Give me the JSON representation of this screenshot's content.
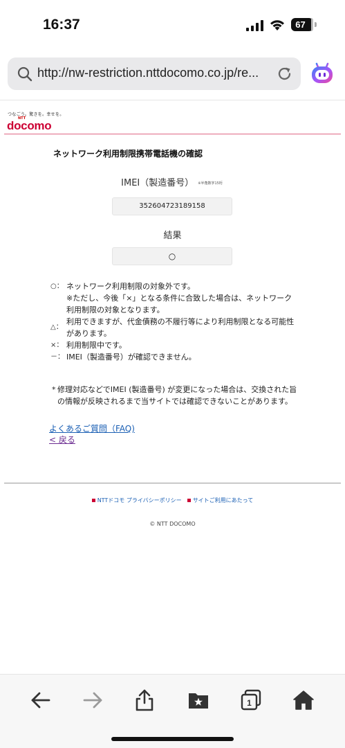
{
  "status": {
    "time": "16:37",
    "battery": "67"
  },
  "browser": {
    "url": "http://nw-restriction.nttdocomo.co.jp/re..."
  },
  "site": {
    "tagline": "つなごう。驚きを。幸せを。",
    "ntt_label": "NTT",
    "logo": "docomo",
    "page_title": "ネットワーク利用制限携帯電話機の確認",
    "imei_label": "IMEI（製造番号）",
    "imei_note": "※半角数字15桁",
    "imei_value": "352604723189158",
    "result_label": "結果",
    "result_value": "○"
  },
  "legend": [
    {
      "symbol": "○：",
      "text": "ネットワーク利用制限の対象外です。"
    },
    {
      "symbol": "",
      "text": "※ただし、今後「×」となる条件に合致した場合は、ネットワーク利用制限の対象となります。"
    },
    {
      "symbol": "△：",
      "text": "利用できますが、代金債務の不履行等により利用制限となる可能性があります。"
    },
    {
      "symbol": "×：",
      "text": "利用制限中です。"
    },
    {
      "symbol": "－：",
      "text": "IMEI（製造番号）が確認できません。"
    }
  ],
  "note": {
    "mark": "*",
    "text": "修理対応などでIMEI (製造番号) が変更になった場合は、交換された旨の情報が反映されるまで当サイトでは確認できないことがあります。"
  },
  "links": {
    "faq": "よくあるご質問（FAQ)",
    "back": "< 戻る"
  },
  "footer": {
    "privacy": "NTTドコモ プライバシーポリシー",
    "terms": "サイトご利用にあたって",
    "copyright": "© NTT DOCOMO"
  },
  "toolbar": {
    "tab_count": "1"
  },
  "colors": {
    "brand": "#cc0033",
    "link": "#1a5fb4",
    "visited_link": "#6b2c91"
  }
}
